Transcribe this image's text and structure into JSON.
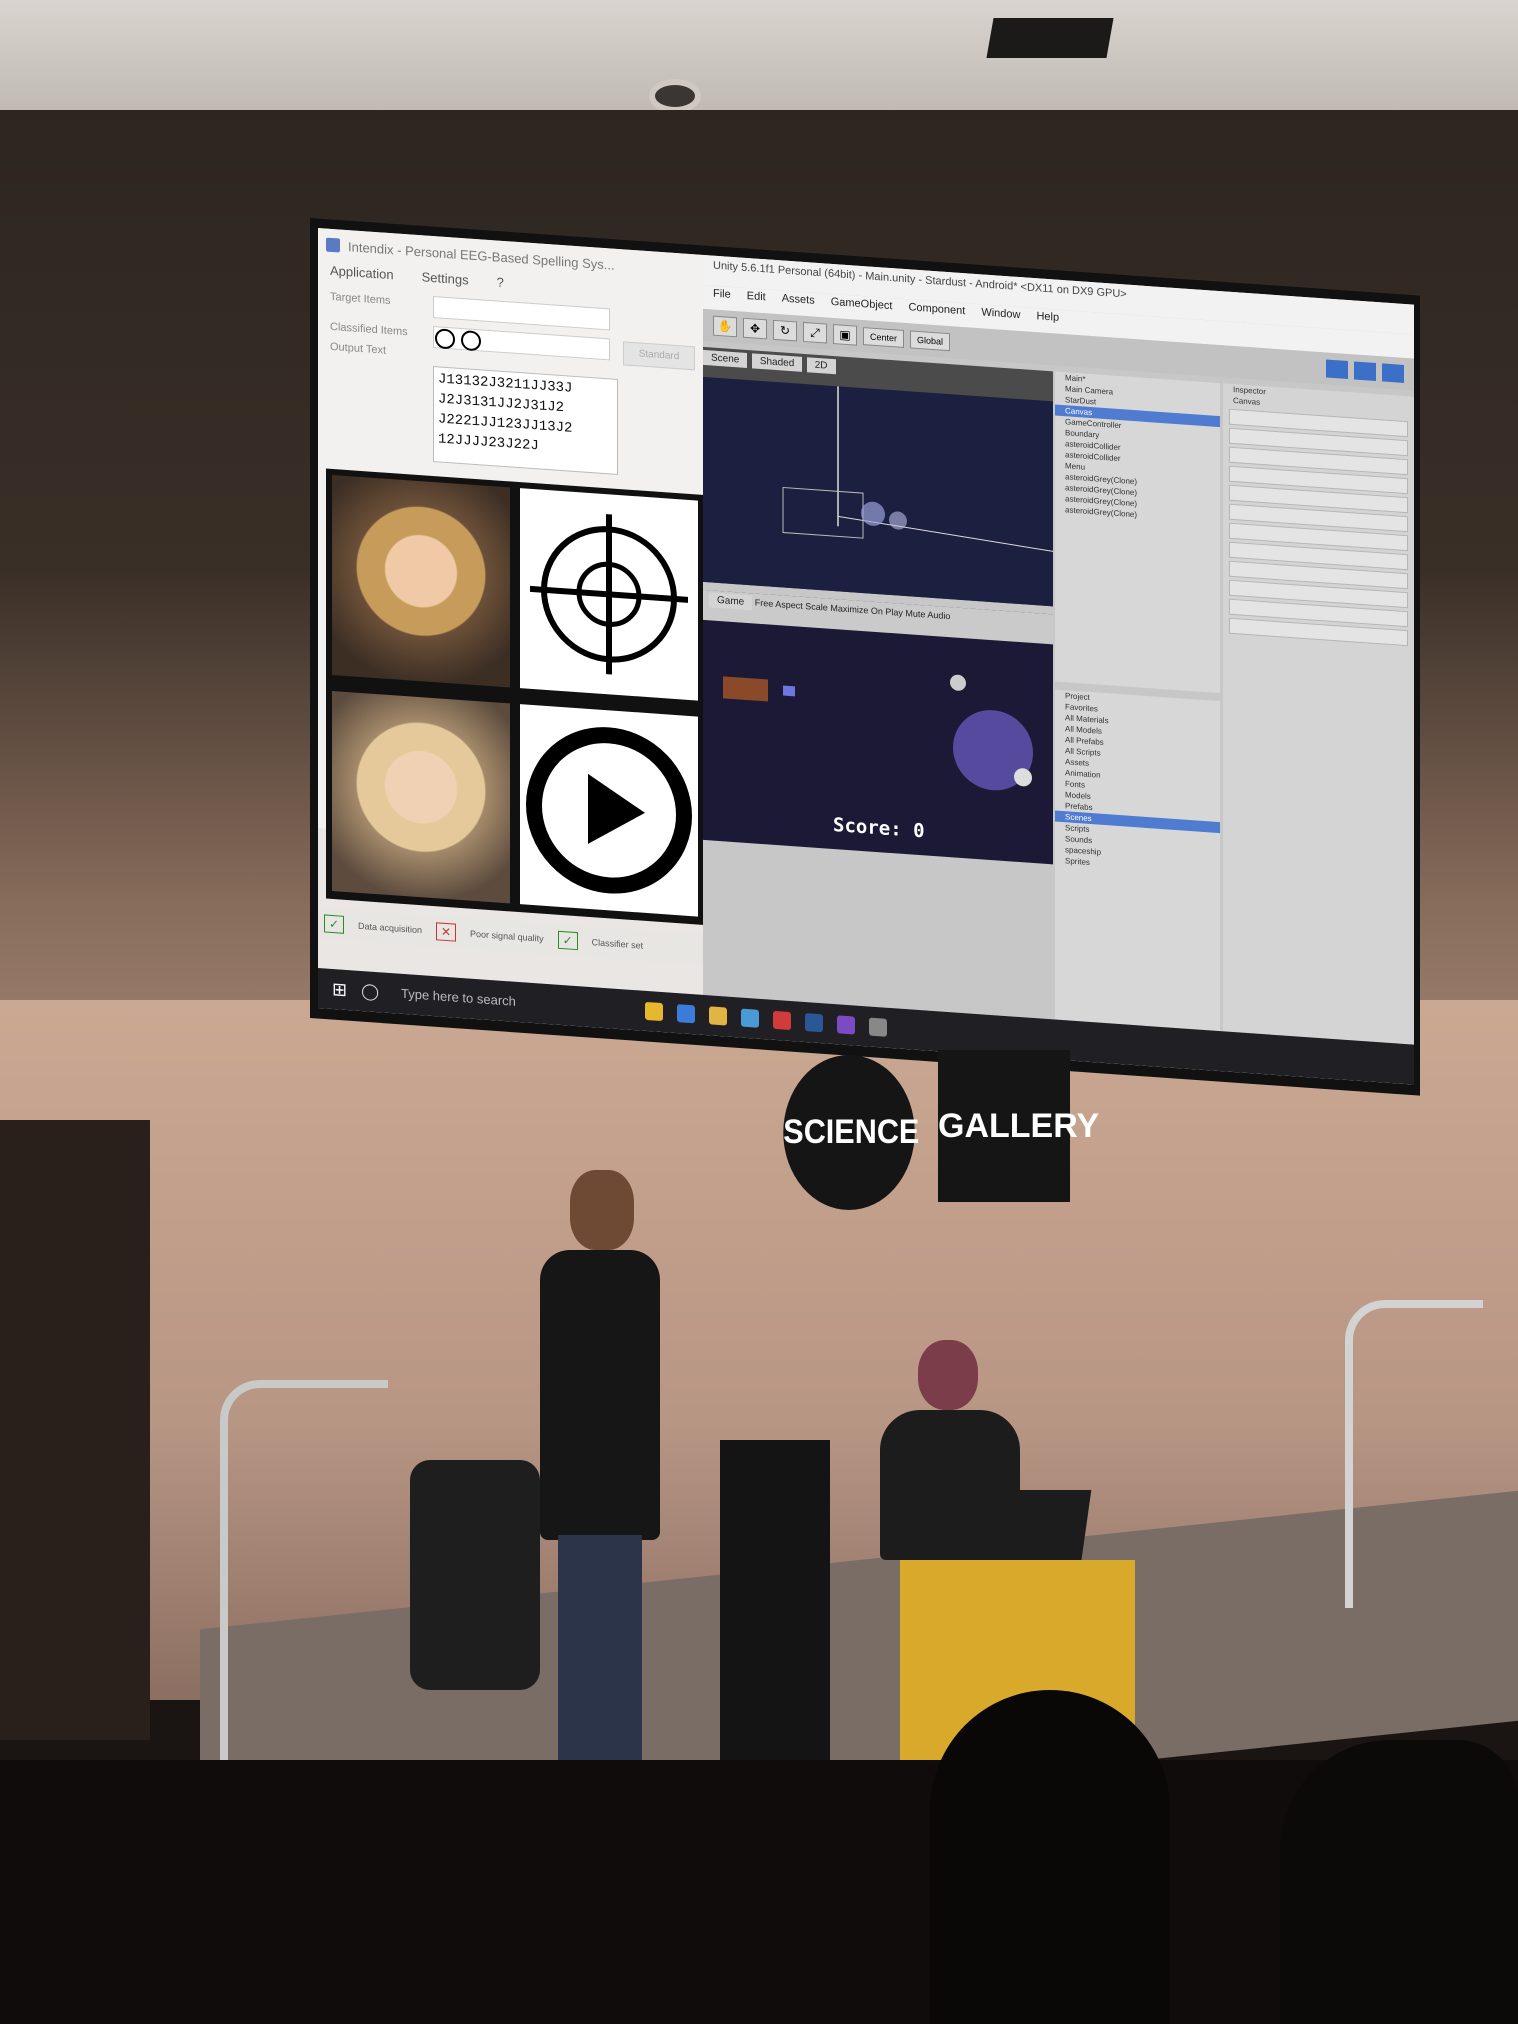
{
  "left_app": {
    "window_title": "Intendix - Personal EEG-Based Spelling Sys...",
    "menu": [
      "Application",
      "Settings",
      "?"
    ],
    "target_items_label": "Target Items",
    "classified_items_label": "Classified Items",
    "output_text_label": "Output Text",
    "button_label": "Standard",
    "output_text": "J13132J3211JJ33J\nJ2J3131JJ2J31J2\nJ2221JJ123JJ13J2\n12JJJJ23J22J",
    "status": {
      "data_acquisition": "Data acquisition",
      "poor_signal": "Poor signal quality",
      "classifier_set": "Classifier set"
    }
  },
  "unity": {
    "window_title": "Unity 5.6.1f1 Personal (64bit) - Main.unity - Stardust - Android* <DX11 on DX9 GPU>",
    "menu": [
      "File",
      "Edit",
      "Assets",
      "GameObject",
      "Component",
      "Window",
      "Help"
    ],
    "toolbar": {
      "center": "Center",
      "global": "Global"
    },
    "scene_tab": "Scene",
    "shaded": "Shaded",
    "mode_2d": "2D",
    "game_tab": "Game",
    "free_aspect": "Free Aspect",
    "scale_label": "Scale",
    "maximize_label": "Maximize On Play",
    "mute_label": "Mute Audio",
    "score": "Score: 0",
    "hierarchy_items": [
      "Main*",
      "Main Camera",
      "StarDust",
      "Canvas",
      "GameController",
      "Boundary",
      "asteroidCollider",
      "asteroidCollider",
      "Menu",
      "asteroidGrey(Clone)",
      "asteroidGrey(Clone)",
      "asteroidGrey(Clone)",
      "asteroidGrey(Clone)"
    ],
    "project_tab": "Project",
    "favorites": [
      "Favorites",
      "All Materials",
      "All Models",
      "All Prefabs",
      "All Scripts"
    ],
    "assets": [
      "Assets",
      "Animation",
      "Fonts",
      "Models",
      "Prefabs",
      "Scenes",
      "Scripts",
      "Sounds",
      "spaceship",
      "Sprites"
    ],
    "inspector_tab": "Inspector",
    "inspector_object": "Canvas"
  },
  "taskbar": {
    "search_placeholder": "Type here to search"
  },
  "logos": {
    "science": "SCIENCE",
    "gallery": "GALLERY"
  }
}
